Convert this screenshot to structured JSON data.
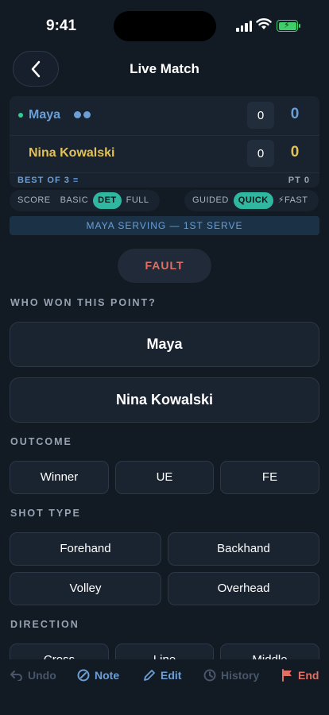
{
  "status": {
    "time": "9:41"
  },
  "header": {
    "title": "Live Match"
  },
  "scoreboard": {
    "players": [
      {
        "name": "Maya",
        "games": "0",
        "points": "0"
      },
      {
        "name": "Nina Kowalski",
        "games": "0",
        "points": "0"
      }
    ],
    "best_of": "BEST OF 3",
    "point_count": "PT 0"
  },
  "mode_toggle": {
    "options": [
      "SCORE",
      "BASIC",
      "DET",
      "FULL"
    ],
    "selected": "DET"
  },
  "speed_toggle": {
    "options": [
      "GUIDED",
      "QUICK",
      "FAST"
    ],
    "selected": "QUICK"
  },
  "serving_status": "MAYA SERVING — 1ST SERVE",
  "fault_label": "FAULT",
  "winner_section": {
    "heading": "WHO WON THIS POINT?",
    "options": [
      "Maya",
      "Nina Kowalski"
    ]
  },
  "outcome_section": {
    "heading": "OUTCOME",
    "options": [
      "Winner",
      "UE",
      "FE"
    ]
  },
  "shot_section": {
    "heading": "SHOT TYPE",
    "options": [
      "Forehand",
      "Backhand",
      "Volley",
      "Overhead"
    ]
  },
  "direction_section": {
    "heading": "DIRECTION",
    "options": [
      "Cross",
      "Line",
      "Middle"
    ]
  },
  "toolbar": {
    "undo": "Undo",
    "note": "Note",
    "edit": "Edit",
    "history": "History",
    "end": "End"
  },
  "colors": {
    "accent": "#2fb7a0",
    "player1": "#6b9fd6",
    "player2": "#e2c159",
    "danger": "#e07063",
    "background": "#121a24"
  }
}
